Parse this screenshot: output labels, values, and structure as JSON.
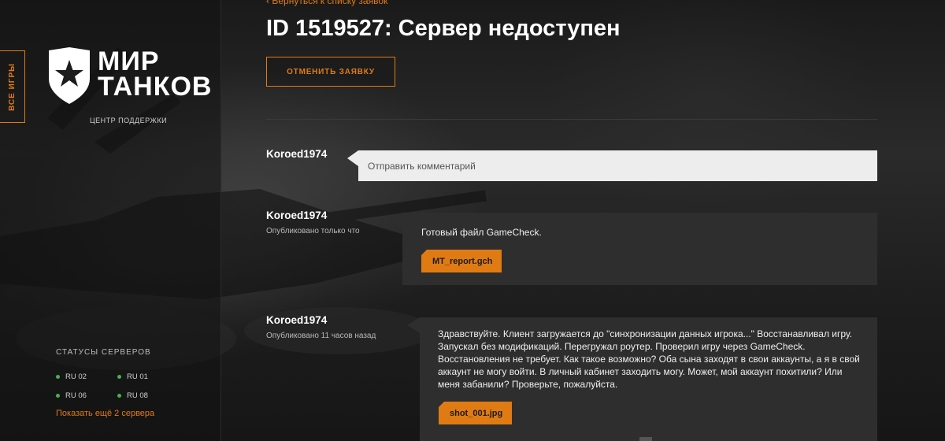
{
  "sidebar": {
    "all_games": "ВСЕ ИГРЫ",
    "logo_line1": "МИР",
    "logo_line2": "ТАНКОВ",
    "support_center": "ЦЕНТР ПОДДЕРЖКИ",
    "server_status_title": "СТАТУСЫ СЕРВЕРОВ",
    "servers": [
      {
        "name": "RU 02",
        "status": "online"
      },
      {
        "name": "RU 01",
        "status": "online"
      },
      {
        "name": "RU 06",
        "status": "online"
      },
      {
        "name": "RU 08",
        "status": "online"
      }
    ],
    "show_more": "Показать ещё 2 сервера",
    "status_color": "#4caf50"
  },
  "header": {
    "back_link": "Вернуться к списку заявок",
    "title": "ID 1519527: Сервер недоступен",
    "cancel_button": "ОТМЕНИТЬ ЗАЯВКУ"
  },
  "comment_form": {
    "author": "Koroed1974",
    "placeholder": "Отправить комментарий"
  },
  "messages": [
    {
      "author": "Koroed1974",
      "published": "Опубликовано только что",
      "text": "Готовый файл GameCheck.",
      "attachment": "MT_report.gch"
    },
    {
      "author": "Koroed1974",
      "published": "Опубликовано 11 часов назад",
      "text": "Здравствуйте. Клиент загружается до \"синхронизации данных игрока...\" Восстанавливал игру. Запускал без модификаций. Перегружал роутер. Проверил игру через GameCheck. Восстановления не требует. Как такое возможно? Оба сына заходят в свои аккаунты, а я в свой аккаунт не могу войти. В личный кабинет заходить могу. Может, мой аккаунт похитили? Или меня забанили? Проверьте, пожалуйста.",
      "attachment": "shot_001.jpg"
    }
  ],
  "colors": {
    "accent": "#e07b14",
    "bubble": "#2e2e2e",
    "input_bg": "#ededed"
  }
}
